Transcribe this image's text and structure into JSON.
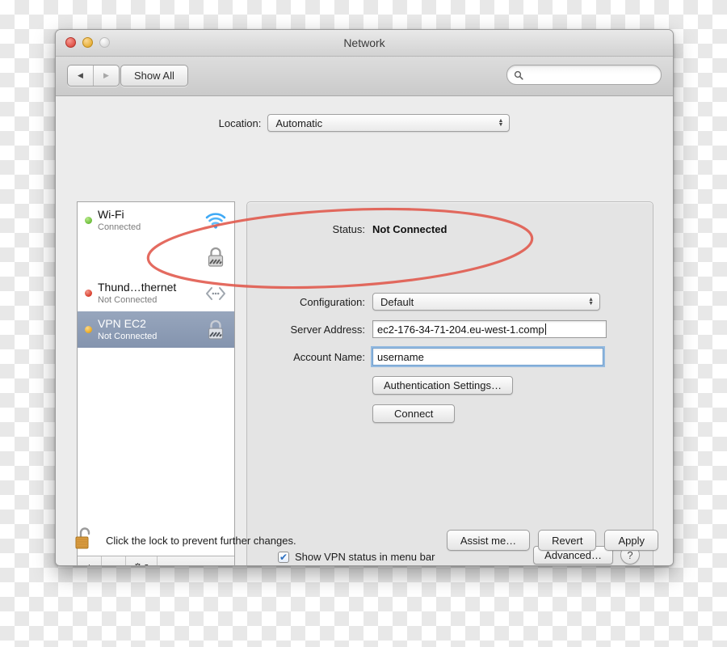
{
  "window": {
    "title": "Network",
    "traffic_lights": [
      "close-button",
      "minimize-button",
      "zoom-button"
    ]
  },
  "toolbar": {
    "back_glyph": "◀",
    "forward_glyph": "▶",
    "show_all_label": "Show All",
    "search": {
      "value": "",
      "placeholder": ""
    }
  },
  "location": {
    "label": "Location:",
    "selected": "Automatic"
  },
  "sidebar": {
    "services": [
      {
        "name": "Wi-Fi",
        "state": "Connected",
        "dot": "green",
        "icon": "wifi-icon",
        "selected": false,
        "redacted": false
      },
      {
        "name": "",
        "state": "",
        "dot": "none",
        "icon": "lock-network-icon",
        "selected": false,
        "redacted": true
      },
      {
        "name": "Thund…thernet",
        "state": "Not Connected",
        "dot": "red",
        "icon": "ethernet-icon",
        "selected": false,
        "redacted": false
      },
      {
        "name": "VPN EC2",
        "state": "Not Connected",
        "dot": "orange",
        "icon": "lock-network-icon",
        "selected": true,
        "redacted": false
      }
    ],
    "toolbar": {
      "add_label": "+",
      "remove_label": "−",
      "gear_label": "⚙",
      "gear_chevron": "▼"
    }
  },
  "panel": {
    "status_label": "Status:",
    "status_value": "Not Connected",
    "configuration_label": "Configuration:",
    "configuration_value": "Default",
    "server_address_label": "Server Address:",
    "server_address_value": "ec2-176-34-71-204.eu-west-1.comp",
    "account_name_label": "Account Name:",
    "account_name_value": "username",
    "auth_settings_label": "Authentication Settings…",
    "connect_label": "Connect",
    "show_vpn_status_label": "Show VPN status in menu bar",
    "show_vpn_status_checked": true,
    "checkmark_glyph": "✔",
    "advanced_label": "Advanced…",
    "help_label": "?"
  },
  "footer": {
    "lock_caption": "Click the lock to prevent further changes.",
    "lock_state": "unlocked",
    "assist_me_label": "Assist me…",
    "revert_label": "Revert",
    "apply_label": "Apply"
  },
  "annotation": {
    "shape": "ellipse",
    "color": "#e0574a"
  },
  "colors": {
    "window_bg": "#ececec",
    "panel_bg": "#e4e4e4",
    "selection_blue": "#8d9cb5",
    "focus_ring": "#7aacdd",
    "annotation_red": "#e0574a"
  }
}
